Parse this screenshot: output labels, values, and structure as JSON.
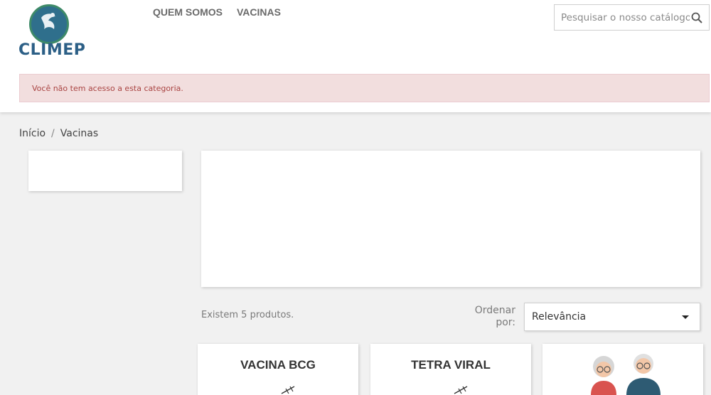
{
  "header": {
    "logo_text": "CLIMEP",
    "nav": [
      {
        "label": "QUEM SOMOS"
      },
      {
        "label": "VACINAS"
      }
    ],
    "search": {
      "placeholder": "Pesquisar o nosso catálogo"
    }
  },
  "alert": {
    "message": "Você não tem acesso a esta categoria."
  },
  "breadcrumb": {
    "items": [
      "Início",
      "Vacinas"
    ],
    "separator": "/"
  },
  "listing": {
    "count_text": "Existem 5 produtos.",
    "sort_label": "Ordenar por:",
    "sort_value": "Relevância"
  },
  "products": [
    {
      "title": "VACINA BCG",
      "icon": "syringe-icon"
    },
    {
      "title": "TETRA VIRAL",
      "icon": "syringe-icon"
    },
    {
      "title": "",
      "icon": "elderly-couple-illustration"
    }
  ],
  "colors": {
    "brand_blue": "#2c5f86",
    "brand_green": "#3e8a68",
    "alert_bg": "#f2dede",
    "alert_text": "#a94442"
  }
}
